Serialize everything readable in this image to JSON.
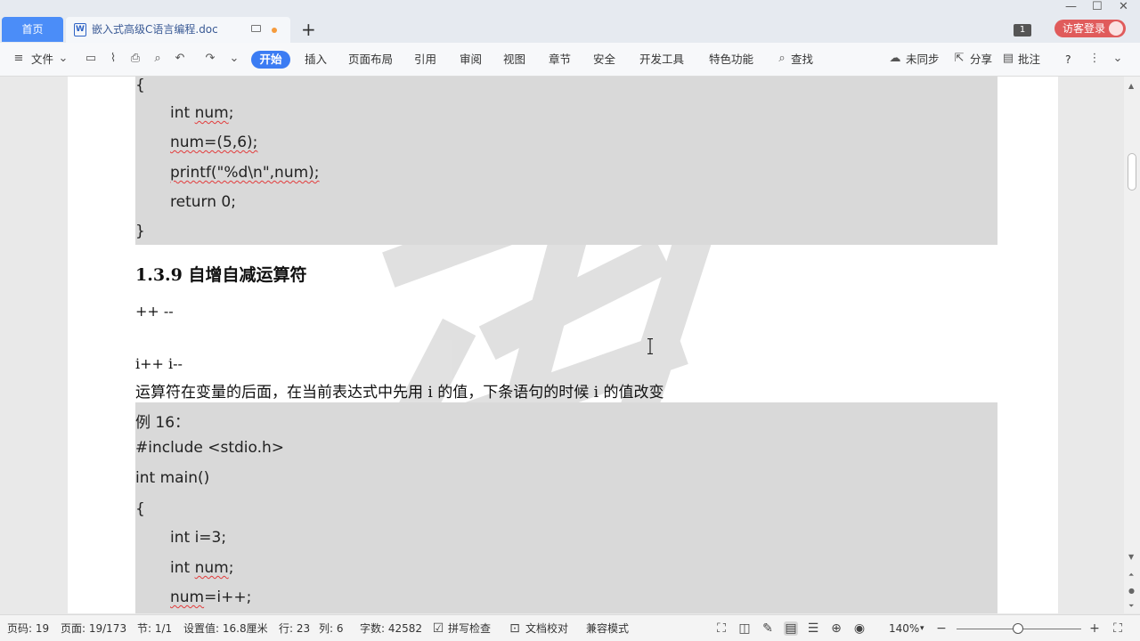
{
  "tabs": {
    "home": "首页",
    "doc": "嵌入式高级C语言编程.doc",
    "new_tab": "+"
  },
  "window": {
    "badge": "1",
    "login": "访客登录",
    "min": "—",
    "max": "☐",
    "close": "✕"
  },
  "ribbon": {
    "file": "文件",
    "items": [
      "开始",
      "插入",
      "页面布局",
      "引用",
      "审阅",
      "视图",
      "章节",
      "安全",
      "开发工具",
      "特色功能"
    ],
    "search": "查找",
    "sync": "未同步",
    "share": "分享",
    "comment": "批注",
    "help": "?",
    "accent": "#3b7cf3"
  },
  "document": {
    "code_top": {
      "brace_open": "{",
      "line1": "int num;",
      "line2": "num=(5,6);",
      "line3": "printf(\"%d\\n\",num);",
      "line4": "return 0;",
      "brace_close": "}"
    },
    "heading": "1.3.9  自增自减运算符",
    "ops": "++     --",
    "postfix": "i++   i--",
    "explain": "运算符在变量的后面，在当前表达式中先用 i 的值，下条语句的时候 i 的值改变",
    "code_bottom": {
      "example": "例 16：",
      "include": "#include <stdio.h>",
      "main": "int main()",
      "brace_open": "{",
      "line1": "int i=3;",
      "line2": "int num;",
      "line3": "num=i++;"
    }
  },
  "status": {
    "page_code": "页码: 19",
    "page": "页面: 19/173",
    "section": "节: 1/1",
    "setting": "设置值: 16.8厘米",
    "row": "行: 23",
    "col": "列: 6",
    "wordcount": "字数: 42582",
    "spell": "拼写检查",
    "proof": "文档校对",
    "compat": "兼容模式",
    "zoom": "140%",
    "zoom_fraction": 0.49
  }
}
